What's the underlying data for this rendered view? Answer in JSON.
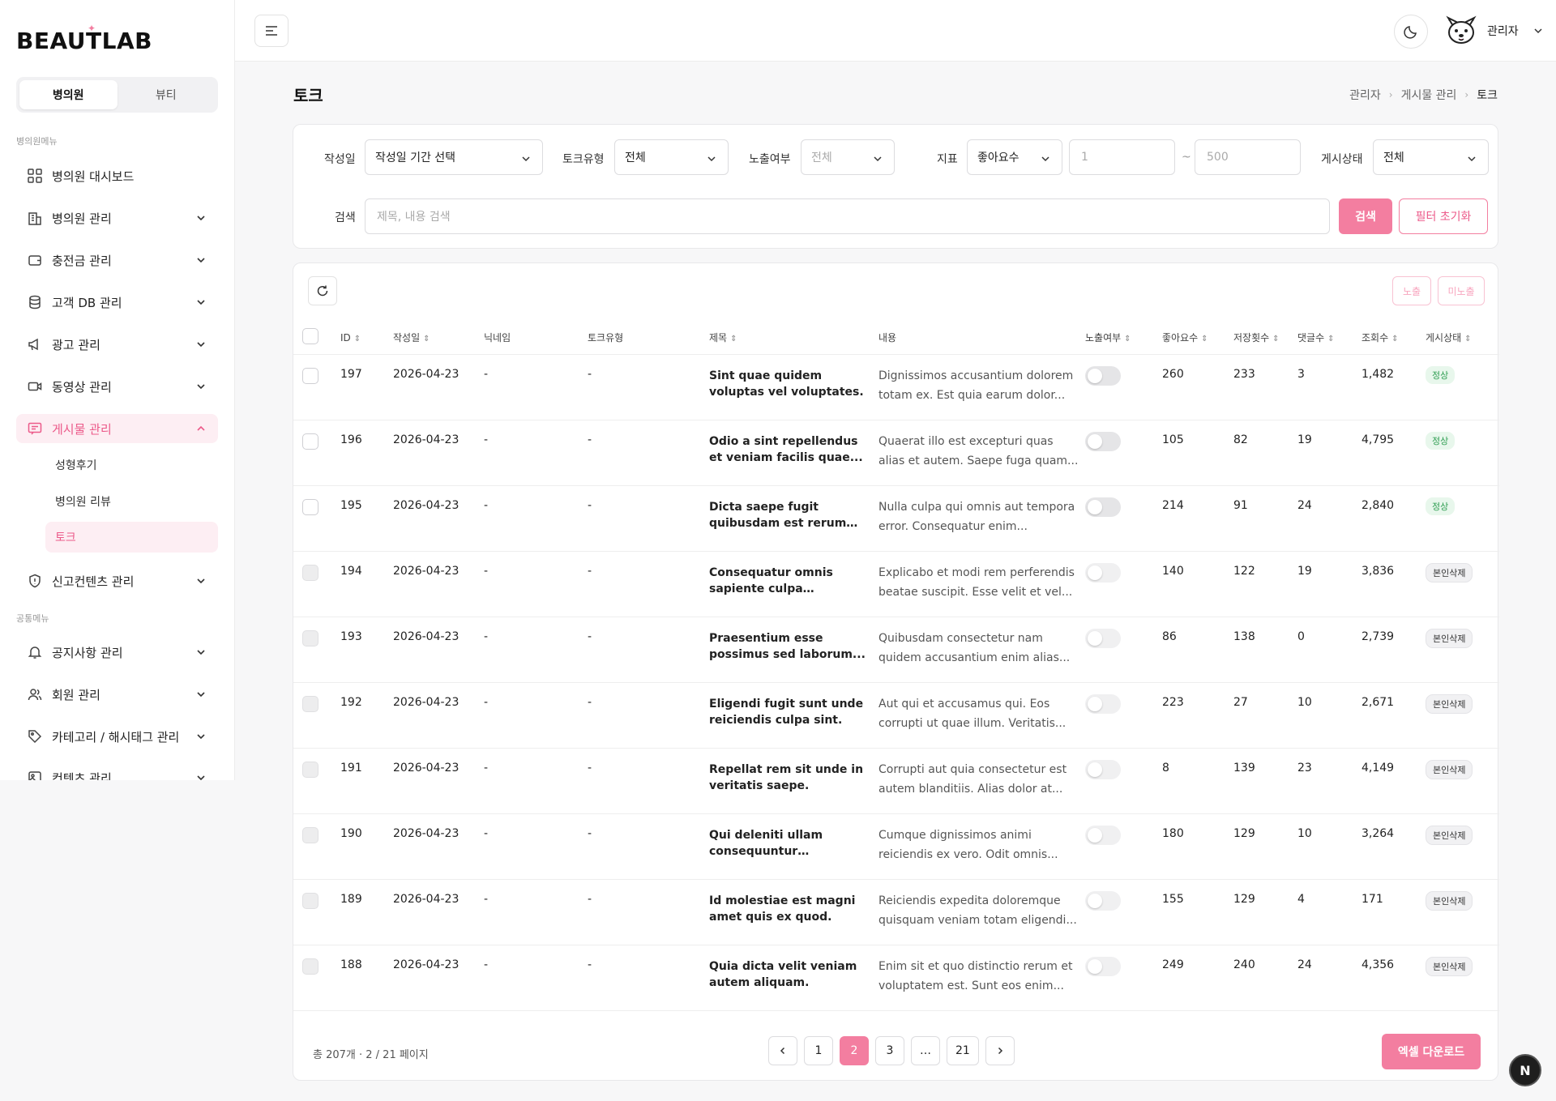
{
  "brand": {
    "logo": "BEAUTLAB"
  },
  "sidebar": {
    "segments": [
      "병의원",
      "뷰티"
    ],
    "section_hospital": "병의원메뉴",
    "section_common": "공통메뉴",
    "items": [
      {
        "label": "병의원 대시보드",
        "icon": "grid-icon"
      },
      {
        "label": "병의원 관리",
        "icon": "building-icon"
      },
      {
        "label": "충전금 관리",
        "icon": "wallet-icon"
      },
      {
        "label": "고객 DB 관리",
        "icon": "database-icon"
      },
      {
        "label": "광고 관리",
        "icon": "megaphone-icon"
      },
      {
        "label": "동영상 관리",
        "icon": "video-icon"
      },
      {
        "label": "게시물 관리",
        "icon": "message-icon"
      },
      {
        "label": "신고컨텐츠 관리",
        "icon": "shield-icon"
      },
      {
        "label": "공지사항 관리",
        "icon": "bell-icon"
      },
      {
        "label": "회원 관리",
        "icon": "users-icon"
      },
      {
        "label": "카테고리 / 해시태그 관리",
        "icon": "tag-icon"
      },
      {
        "label": "컨텐츠 관리",
        "icon": "image-icon"
      }
    ],
    "sub_items": [
      "성형후기",
      "병의원 리뷰",
      "토크"
    ]
  },
  "header": {
    "user": "관리자"
  },
  "page": {
    "title": "토크",
    "breadcrumb": [
      "관리자",
      "게시물 관리",
      "토크"
    ]
  },
  "filters": {
    "date_label": "작성일",
    "date_value": "작성일 기간 선택",
    "type_label": "토크유형",
    "type_value": "전체",
    "expose_label": "노출여부",
    "expose_value": "전체",
    "metric_label": "지표",
    "metric_value": "좋아요수",
    "min_placeholder": "1",
    "tilde": "~",
    "max_placeholder": "500",
    "status_label": "게시상태",
    "status_value": "전체",
    "search_label": "검색",
    "search_placeholder": "제목, 내용 검색",
    "search_button": "검색",
    "reset_button": "필터 초기화"
  },
  "table": {
    "expose_button": "노출",
    "hide_button": "미노출",
    "columns": [
      "ID",
      "작성일",
      "닉네임",
      "토크유형",
      "제목",
      "내용",
      "노출여부",
      "좋아요수",
      "저장횟수",
      "댓글수",
      "조회수",
      "게시상태"
    ],
    "rows": [
      {
        "id": "197",
        "date": "2026-04-23",
        "nick": "-",
        "type": "-",
        "title": "Sint quae quidem voluptas vel voluptates.",
        "content": "Dignissimos accusantium dolorem totam ex. Est quia earum dolor...",
        "likes": "260",
        "saves": "233",
        "comments": "3",
        "views": "1,482",
        "status": "정상",
        "ok": true
      },
      {
        "id": "196",
        "date": "2026-04-23",
        "nick": "-",
        "type": "-",
        "title": "Odio a sint repellendus et veniam facilis quae...",
        "content": "Quaerat illo est excepturi quas alias et autem. Saepe fuga quam...",
        "likes": "105",
        "saves": "82",
        "comments": "19",
        "views": "4,795",
        "status": "정상",
        "ok": true
      },
      {
        "id": "195",
        "date": "2026-04-23",
        "nick": "-",
        "type": "-",
        "title": "Dicta saepe fugit quibusdam est rerum qui.",
        "content": "Nulla culpa qui omnis aut tempora error. Consequatur enim...",
        "likes": "214",
        "saves": "91",
        "comments": "24",
        "views": "2,840",
        "status": "정상",
        "ok": true
      },
      {
        "id": "194",
        "date": "2026-04-23",
        "nick": "-",
        "type": "-",
        "title": "Consequatur omnis sapiente culpa provident.",
        "content": "Explicabo et modi rem perferendis beatae suscipit. Esse velit et vel...",
        "likes": "140",
        "saves": "122",
        "comments": "19",
        "views": "3,836",
        "status": "본인삭제",
        "ok": false
      },
      {
        "id": "193",
        "date": "2026-04-23",
        "nick": "-",
        "type": "-",
        "title": "Praesentium esse possimus sed laborum...",
        "content": "Quibusdam consectetur nam quidem accusantium enim alias...",
        "likes": "86",
        "saves": "138",
        "comments": "0",
        "views": "2,739",
        "status": "본인삭제",
        "ok": false
      },
      {
        "id": "192",
        "date": "2026-04-23",
        "nick": "-",
        "type": "-",
        "title": "Eligendi fugit sunt unde reiciendis culpa sint.",
        "content": "Aut qui et accusamus qui. Eos corrupti ut quae illum. Veritatis...",
        "likes": "223",
        "saves": "27",
        "comments": "10",
        "views": "2,671",
        "status": "본인삭제",
        "ok": false
      },
      {
        "id": "191",
        "date": "2026-04-23",
        "nick": "-",
        "type": "-",
        "title": "Repellat rem sit unde in veritatis saepe.",
        "content": "Corrupti aut quia consectetur est autem blanditiis. Alias dolor at...",
        "likes": "8",
        "saves": "139",
        "comments": "23",
        "views": "4,149",
        "status": "본인삭제",
        "ok": false
      },
      {
        "id": "190",
        "date": "2026-04-23",
        "nick": "-",
        "type": "-",
        "title": "Qui deleniti ullam consequuntur doloremque.",
        "content": "Cumque dignissimos animi reiciendis ex vero. Odit omnis...",
        "likes": "180",
        "saves": "129",
        "comments": "10",
        "views": "3,264",
        "status": "본인삭제",
        "ok": false
      },
      {
        "id": "189",
        "date": "2026-04-23",
        "nick": "-",
        "type": "-",
        "title": "Id molestiae est magni amet quis ex quod.",
        "content": "Reiciendis expedita doloremque quisquam veniam totam eligendi...",
        "likes": "155",
        "saves": "129",
        "comments": "4",
        "views": "171",
        "status": "본인삭제",
        "ok": false
      },
      {
        "id": "188",
        "date": "2026-04-23",
        "nick": "-",
        "type": "-",
        "title": "Quia dicta velit veniam autem aliquam.",
        "content": "Enim sit et quo distinctio rerum et voluptatem est. Sunt eos enim...",
        "likes": "249",
        "saves": "240",
        "comments": "24",
        "views": "4,356",
        "status": "본인삭제",
        "ok": false
      }
    ]
  },
  "pagination": {
    "info": "총 207개 · 2 / 21 페이지",
    "pages": [
      "1",
      "2",
      "3",
      "…",
      "21"
    ],
    "current": "2"
  },
  "excel_button": "엑셀 다운로드",
  "fab": "N",
  "colors": {
    "accent": "#f37ea0",
    "accent_soft": "#fdeef3",
    "ok_text": "#2f9e52"
  }
}
